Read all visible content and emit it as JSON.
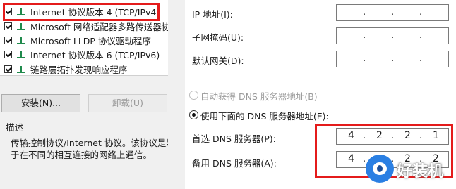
{
  "components": {
    "items": [
      {
        "label": "Internet 协议版本 4 (TCP/IPv4)",
        "checked": true
      },
      {
        "label": "Microsoft 网络适配器多路传送器协",
        "checked": true
      },
      {
        "label": "Microsoft LLDP 协议驱动程序",
        "checked": true
      },
      {
        "label": "Internet 协议版本 6 (TCP/IPv6)",
        "checked": true
      },
      {
        "label": "链路层拓扑发现响应程序",
        "checked": true
      }
    ]
  },
  "buttons": {
    "install": "安装(N)...",
    "uninstall": "卸载(U)"
  },
  "description": {
    "title": "描述",
    "line1": "传输控制协议/Internet 协议。该协议是默",
    "line2": "于在不同的相互连接的网络上通信。"
  },
  "ip_section": {
    "ip_label": "IP 地址(I):",
    "mask_label": "子网掩码(U):",
    "gateway_label": "默认网关(D):"
  },
  "dns": {
    "auto_label": "自动获得 DNS 服务器地址(B)",
    "manual_label": "使用下面的 DNS 服务器地址(E):",
    "preferred_label": "首选 DNS 服务器(P):",
    "alternate_label": "备用 DNS 服务器(A):",
    "preferred": [
      "4",
      "2",
      "2",
      "1"
    ],
    "alternate": [
      "4",
      "",
      "2",
      "2"
    ]
  },
  "watermark": {
    "text": "好装机"
  },
  "colors": {
    "highlight": "#e41b1b",
    "watermark_blue": "#2a7fe3"
  }
}
